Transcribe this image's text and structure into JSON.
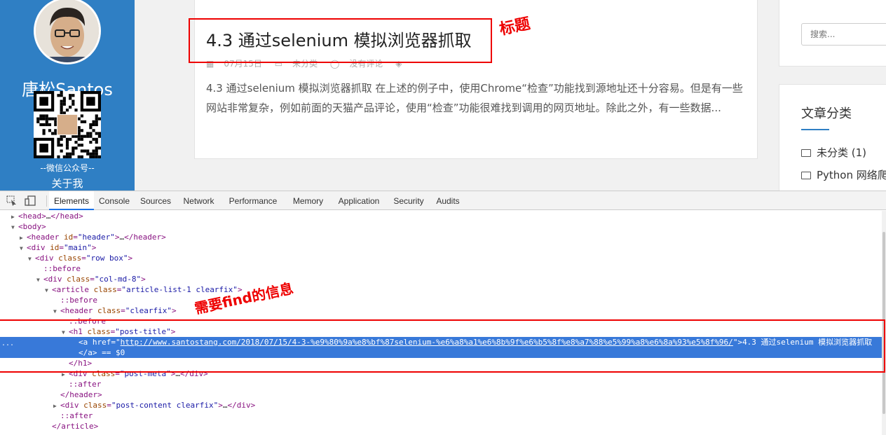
{
  "site": {
    "author_name": "唐松Santos",
    "qr_caption": "--微信公众号--",
    "about_label": "关于我",
    "post_title": "4.3 通过selenium 模拟浏览器抓取",
    "post_meta": {
      "date": "07月15日",
      "category": "未分类",
      "comments": "没有评论"
    },
    "post_excerpt": "4.3 通过selenium 模拟浏览器抓取 在上述的例子中，使用Chrome“检查”功能找到源地址还十分容易。但是有一些网站非常复杂，例如前面的天猫产品评论，使用“检查”功能很难找到调用的网页地址。除此之外，有一些数据...",
    "search_placeholder": "搜索...",
    "categories_heading": "文章分类",
    "categories": [
      {
        "label": "未分类 (1)"
      },
      {
        "label": "Python 网络爬"
      }
    ]
  },
  "devtools": {
    "tabs": [
      "Elements",
      "Console",
      "Sources",
      "Network",
      "Performance",
      "Memory",
      "Application",
      "Security",
      "Audits"
    ],
    "active_tab": "Elements",
    "selected_marker": "...",
    "href_value": "http://www.santostang.com/2018/07/15/4-3-%e9%80%9a%e8%bf%87selenium-%e6%a8%a1%e6%8b%9f%e6%b5%8f%e8%a7%88%e5%99%a8%e6%8a%93%e5%8f%96/",
    "selected_text": "4.3 通过selenium 模拟浏览器抓取",
    "selected_close": "</a> == $0"
  },
  "annotations": {
    "title_note": "标题",
    "find_note": "需要find的信息"
  },
  "colors": {
    "sidebar_blue": "#2f7fc4",
    "annotation_red": "#e00000",
    "selected_row": "#3879d9",
    "devtools_tab_active": "#1a73e8"
  },
  "icons": [
    "inspect-icon",
    "device-toggle-icon",
    "calendar-icon",
    "folder-icon",
    "comment-icon",
    "tag-icon"
  ]
}
